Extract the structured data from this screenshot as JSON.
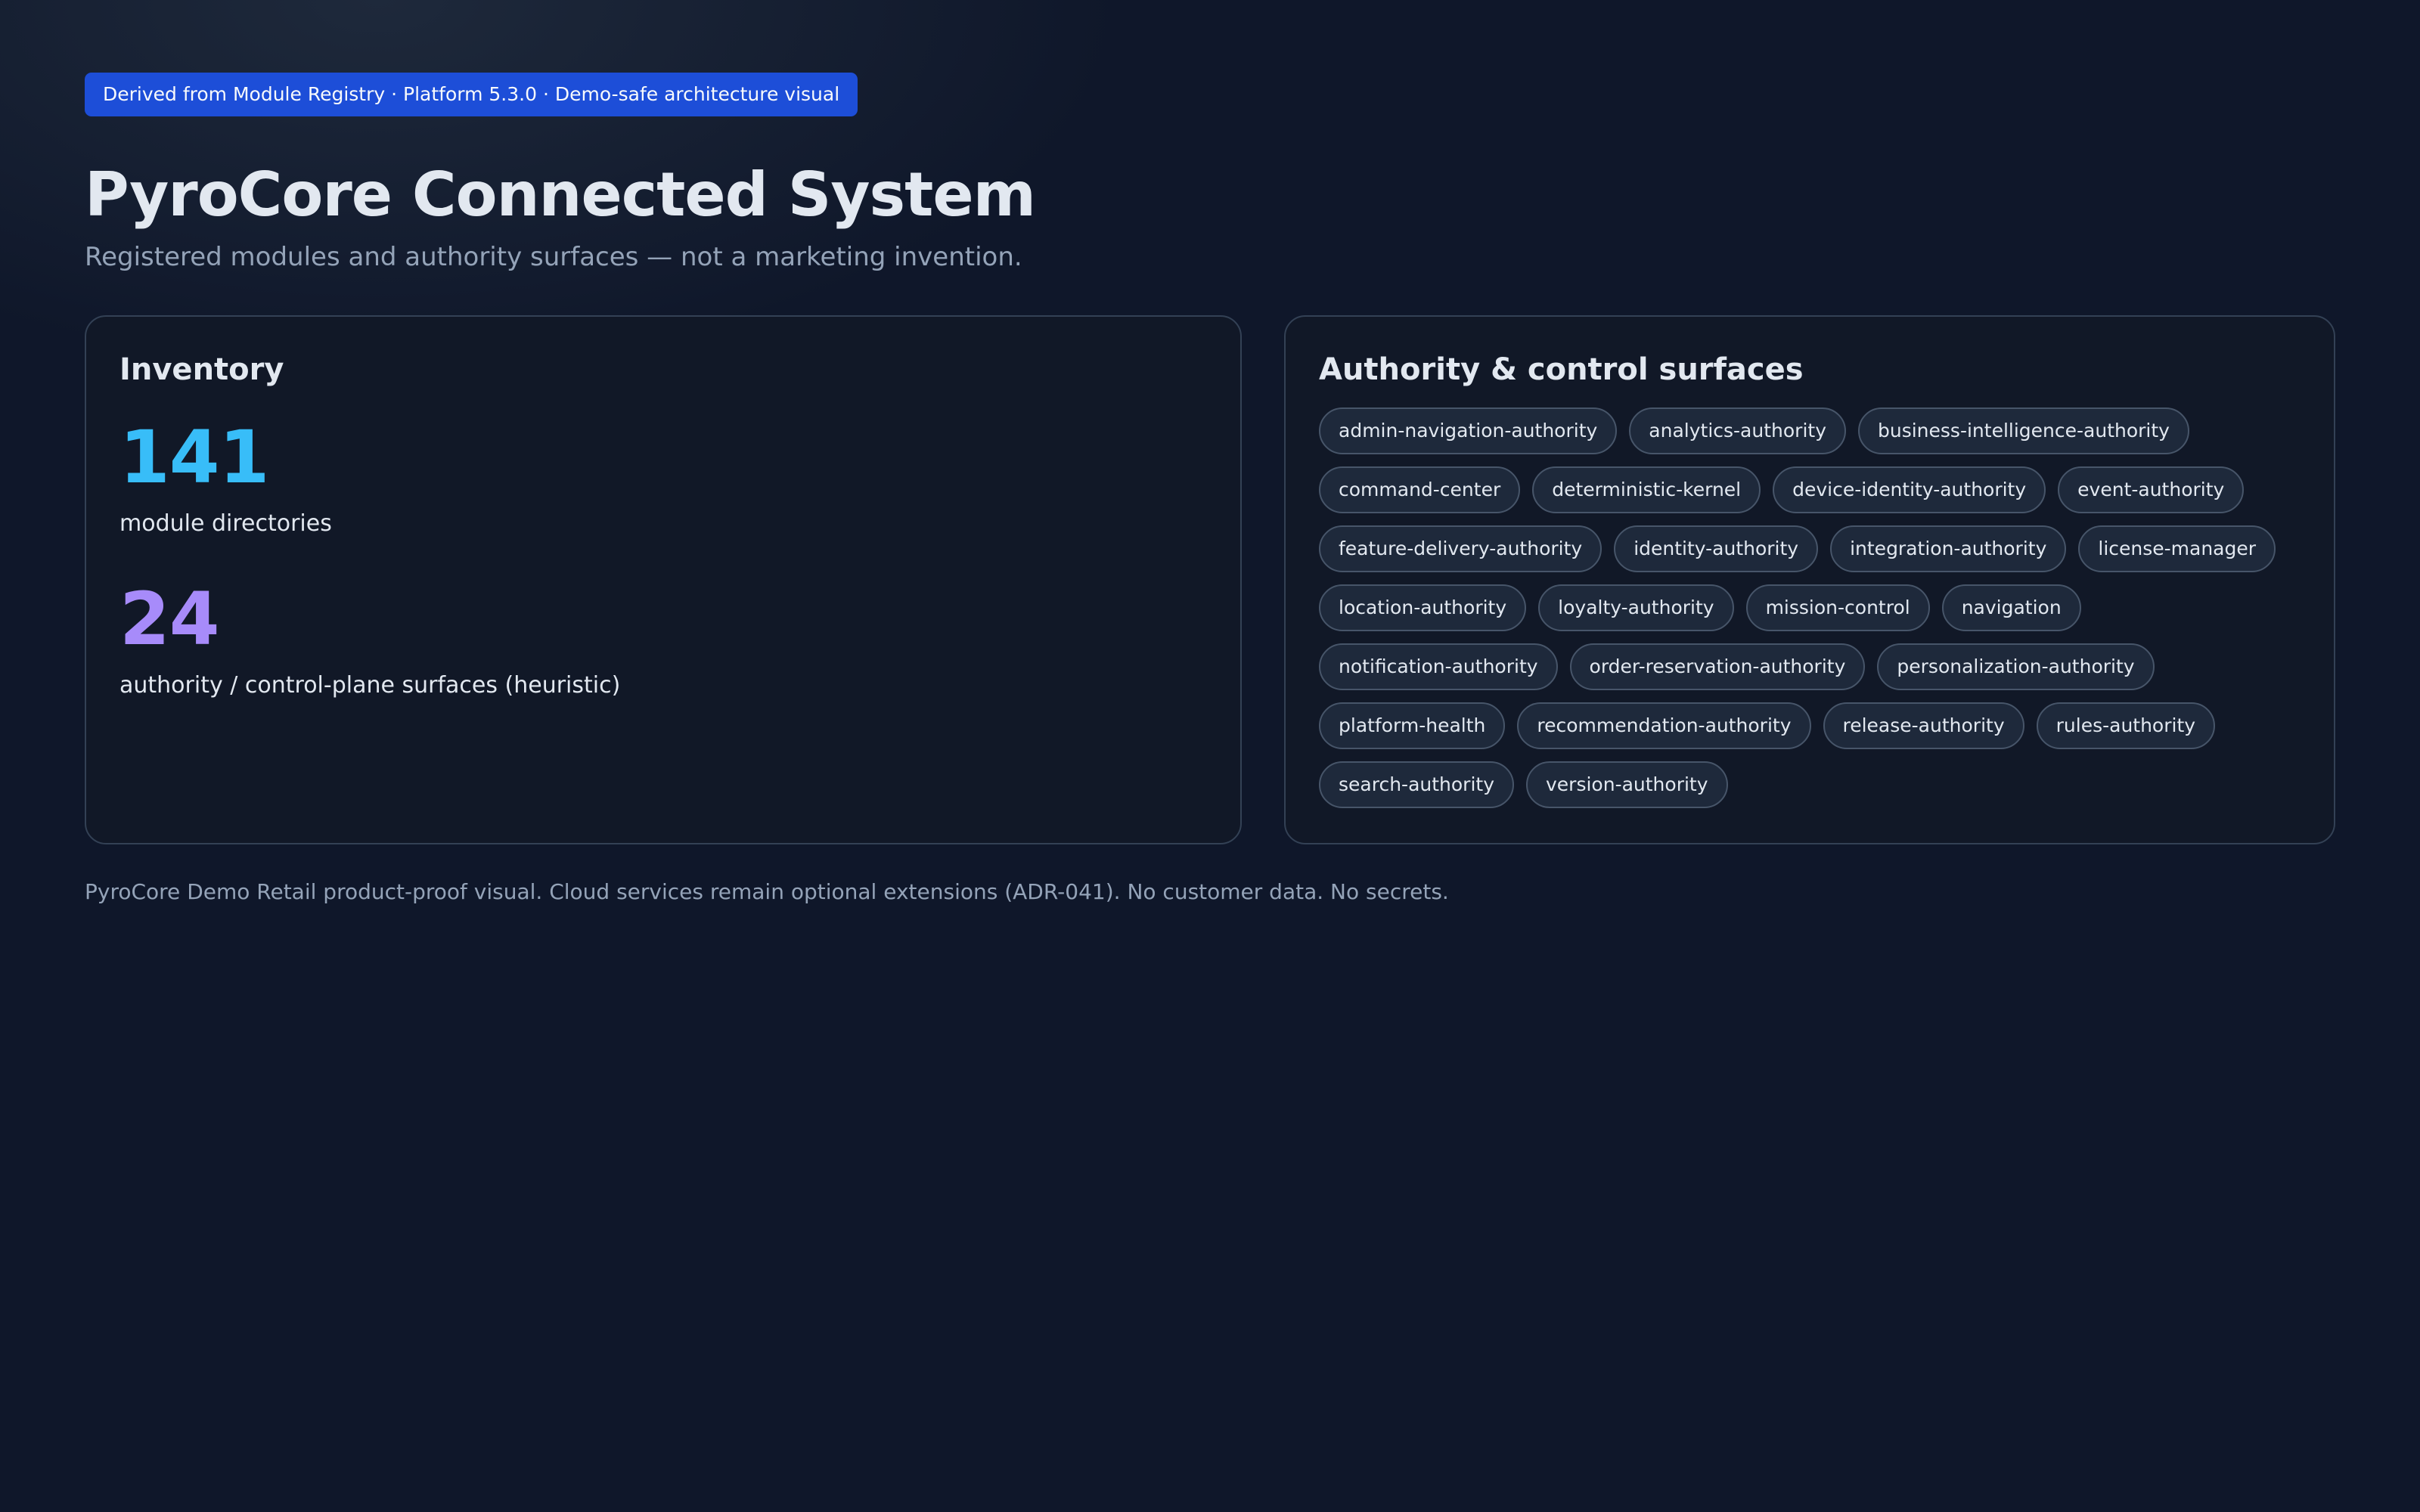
{
  "source_badge": "Derived from Module Registry · Platform 5.3.0 · Demo-safe architecture visual",
  "title": "PyroCore Connected System",
  "subtitle": "Registered modules and authority surfaces — not a marketing invention.",
  "inventory": {
    "heading": "Inventory",
    "metrics": [
      {
        "value": "141",
        "label": "module directories",
        "color": "#38bdf8"
      },
      {
        "value": "24",
        "label": "authority / control-plane surfaces (heuristic)",
        "color": "#a78bfa"
      }
    ]
  },
  "authority": {
    "heading": "Authority & control surfaces",
    "surfaces": [
      "admin-navigation-authority",
      "analytics-authority",
      "business-intelligence-authority",
      "command-center",
      "deterministic-kernel",
      "device-identity-authority",
      "event-authority",
      "feature-delivery-authority",
      "identity-authority",
      "integration-authority",
      "license-manager",
      "location-authority",
      "loyalty-authority",
      "mission-control",
      "navigation",
      "notification-authority",
      "order-reservation-authority",
      "personalization-authority",
      "platform-health",
      "recommendation-authority",
      "release-authority",
      "rules-authority",
      "search-authority",
      "version-authority"
    ]
  },
  "footer": "PyroCore Demo Retail product-proof visual. Cloud services remain optional extensions (ADR-041). No customer data. No secrets.",
  "colors": {
    "background": "#0f172a",
    "badge": "#1d4ed8",
    "accent_blue": "#38bdf8",
    "accent_purple": "#a78bfa"
  }
}
